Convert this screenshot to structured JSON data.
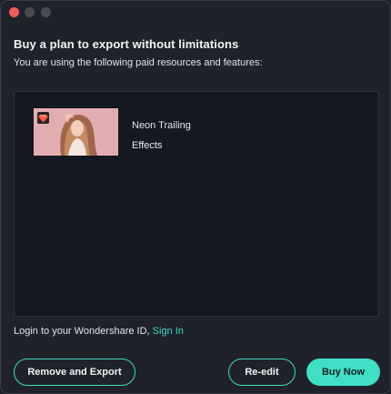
{
  "window": {
    "traffic_lights": [
      "close",
      "minimize",
      "maximize"
    ]
  },
  "header": {
    "title": "Buy a plan to export without limitations",
    "subtitle": "You are using the following paid resources and features:"
  },
  "resources": [
    {
      "name_line1": "Neon Trailing",
      "name_line2": "Effects",
      "badge_icon": "gem-icon"
    }
  ],
  "login": {
    "prefix": "Login to your Wondershare ID,",
    "link": "Sign In"
  },
  "buttons": {
    "remove_export": "Remove and Export",
    "reedit": "Re-edit",
    "buy_now": "Buy Now"
  },
  "colors": {
    "accent": "#3dd9c1",
    "background": "#1f222a",
    "panel": "#151821"
  }
}
